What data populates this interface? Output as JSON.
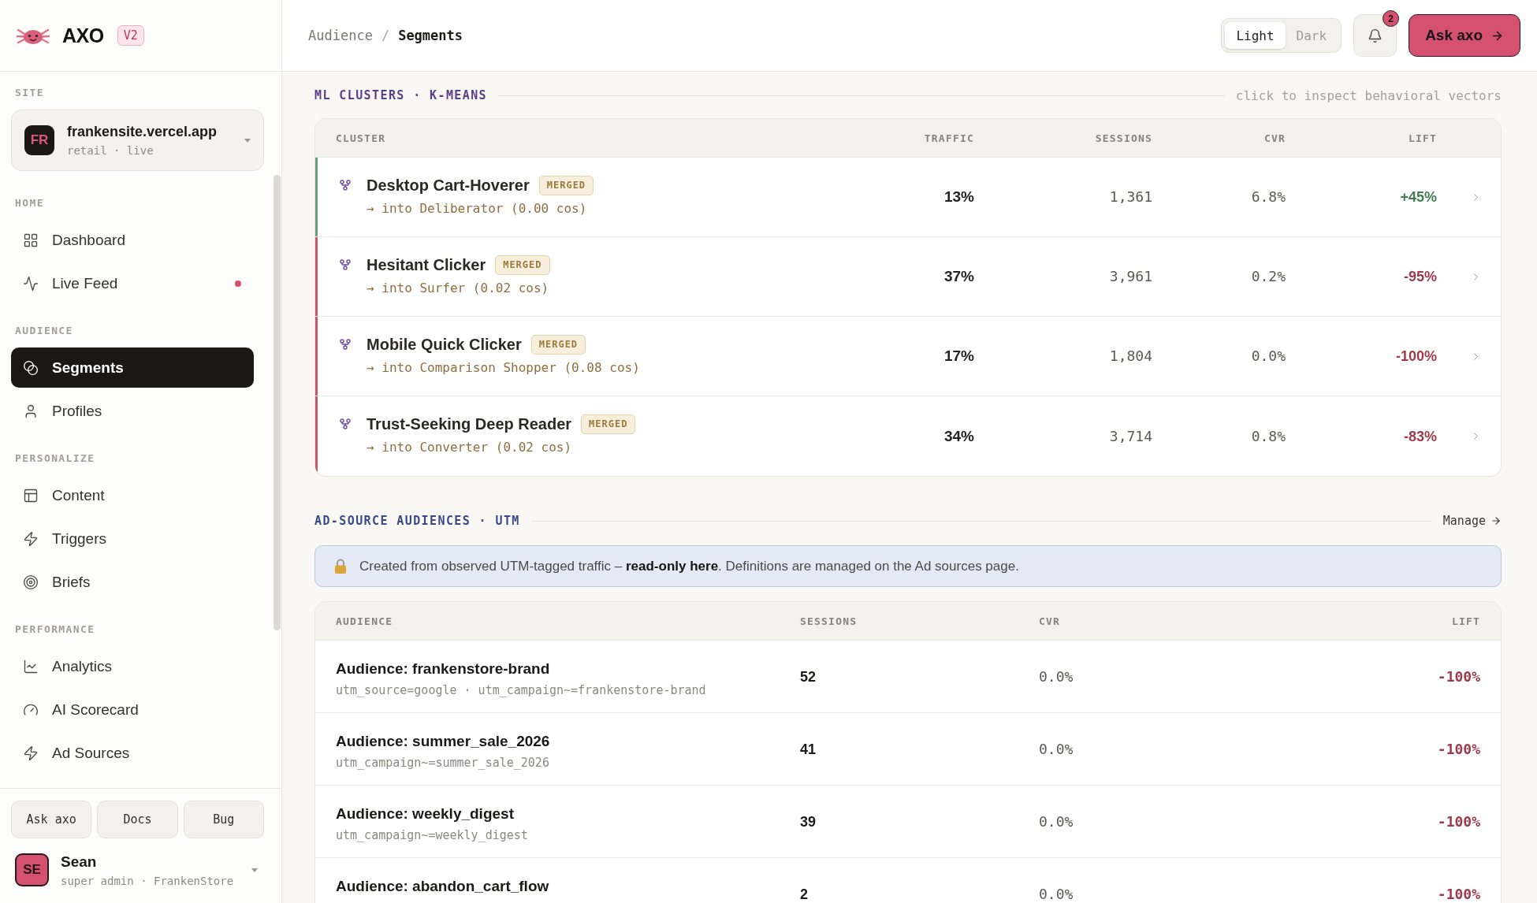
{
  "sidebar": {
    "brand": {
      "name": "AXO",
      "version": "V2"
    },
    "site_label": "SITE",
    "site": {
      "initials": "FR",
      "name": "frankensite.vercel.app",
      "meta": "retail · live"
    },
    "nav_groups": [
      {
        "label": "HOME",
        "items": [
          {
            "label": "Dashboard",
            "selected": false,
            "live": false
          },
          {
            "label": "Live Feed",
            "selected": false,
            "live": true
          }
        ]
      },
      {
        "label": "AUDIENCE",
        "items": [
          {
            "label": "Segments",
            "selected": true,
            "live": false
          },
          {
            "label": "Profiles",
            "selected": false,
            "live": false
          }
        ]
      },
      {
        "label": "PERSONALIZE",
        "items": [
          {
            "label": "Content",
            "selected": false,
            "live": false
          },
          {
            "label": "Triggers",
            "selected": false,
            "live": false
          },
          {
            "label": "Briefs",
            "selected": false,
            "live": false
          }
        ]
      },
      {
        "label": "PERFORMANCE",
        "items": [
          {
            "label": "Analytics",
            "selected": false,
            "live": false
          },
          {
            "label": "AI Scorecard",
            "selected": false,
            "live": false
          },
          {
            "label": "Ad Sources",
            "selected": false,
            "live": false
          }
        ]
      }
    ],
    "footer_buttons": [
      "Ask axo",
      "Docs",
      "Bug"
    ],
    "user": {
      "initials": "SE",
      "name": "Sean",
      "meta": "super admin · FrankenStore"
    }
  },
  "header": {
    "breadcrumbs": [
      {
        "label": "Audience",
        "current": false
      },
      {
        "label": "Segments",
        "current": true
      }
    ],
    "separator": "/",
    "theme_toggle": [
      {
        "label": "Light",
        "selected": true
      },
      {
        "label": "Dark",
        "selected": false
      }
    ],
    "notification_count": "2",
    "ask_button": "Ask axo"
  },
  "ml_clusters": {
    "title": "ML CLUSTERS · K-MEANS",
    "hint": "click to inspect behavioral vectors",
    "columns": [
      "CLUSTER",
      "TRAFFIC",
      "SESSIONS",
      "CVR",
      "LIFT"
    ],
    "rows": [
      {
        "name": "Desktop Cart-Hoverer",
        "badge": "MERGED",
        "detail": "→ into Deliberator (0.00 cos)",
        "traffic": "13%",
        "sessions": "1,361",
        "cvr": "6.8%",
        "lift": "+45%",
        "positive": true
      },
      {
        "name": "Hesitant Clicker",
        "badge": "MERGED",
        "detail": "→ into Surfer (0.02 cos)",
        "traffic": "37%",
        "sessions": "3,961",
        "cvr": "0.2%",
        "lift": "-95%",
        "positive": false
      },
      {
        "name": "Mobile Quick Clicker",
        "badge": "MERGED",
        "detail": "→ into Comparison Shopper (0.08 cos)",
        "traffic": "17%",
        "sessions": "1,804",
        "cvr": "0.0%",
        "lift": "-100%",
        "positive": false
      },
      {
        "name": "Trust-Seeking Deep Reader",
        "badge": "MERGED",
        "detail": "→ into Converter (0.02 cos)",
        "traffic": "34%",
        "sessions": "3,714",
        "cvr": "0.8%",
        "lift": "-83%",
        "positive": false
      }
    ]
  },
  "ad_source_audiences": {
    "title": "AD-SOURCE AUDIENCES · UTM",
    "manage_link": "Manage",
    "notice": "Created from observed UTM-tagged traffic – **read-only here**. Definitions are managed on the Ad sources page.",
    "columns": [
      "AUDIENCE",
      "SESSIONS",
      "CVR",
      "LIFT"
    ],
    "rows": [
      {
        "name": "Audience: frankenstore-brand",
        "detail": "utm_source=google · utm_campaign~=frankenstore-brand",
        "sessions": "52",
        "cvr": "0.0%",
        "lift": "-100%",
        "positive": false
      },
      {
        "name": "Audience: summer_sale_2026",
        "detail": "utm_campaign~=summer_sale_2026",
        "sessions": "41",
        "cvr": "0.0%",
        "lift": "-100%",
        "positive": false
      },
      {
        "name": "Audience: weekly_digest",
        "detail": "utm_campaign~=weekly_digest",
        "sessions": "39",
        "cvr": "0.0%",
        "lift": "-100%",
        "positive": false
      },
      {
        "name": "Audience: abandon_cart_flow",
        "sessions": "2",
        "cvr": "0.0%",
        "lift": "-100%",
        "positive": false
      }
    ]
  }
}
